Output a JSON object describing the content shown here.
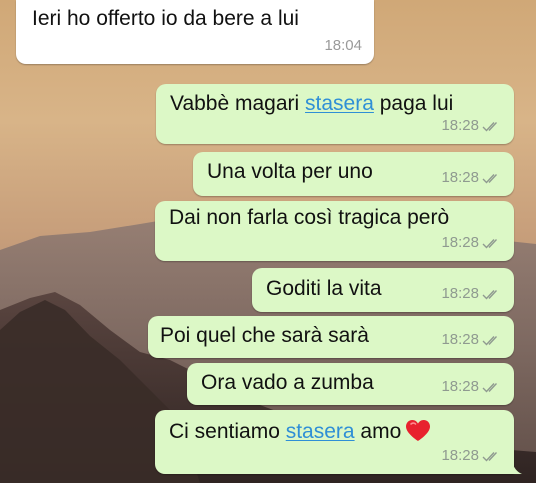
{
  "conversation": {
    "messages": [
      {
        "direction": "in",
        "text": "Ieri ho offerto io da bere a lui",
        "time": "18:04"
      },
      {
        "direction": "out",
        "parts": [
          "Vabbè magari ",
          "stasera",
          " paga lui"
        ],
        "time": "18:28",
        "status": "read"
      },
      {
        "direction": "out",
        "text": "Una volta per uno",
        "time": "18:28",
        "status": "read"
      },
      {
        "direction": "out",
        "text": "Dai non farla così tragica però",
        "time": "18:28",
        "status": "read"
      },
      {
        "direction": "out",
        "text": "Goditi la vita",
        "time": "18:28",
        "status": "read"
      },
      {
        "direction": "out",
        "text": "Poi quel che sarà sarà",
        "time": "18:28",
        "status": "read"
      },
      {
        "direction": "out",
        "text": "Ora vado a zumba",
        "time": "18:28",
        "status": "read"
      },
      {
        "direction": "out",
        "parts": [
          "Ci sentiamo ",
          "stasera",
          " amo"
        ],
        "emoji": "red-heart",
        "time": "18:28",
        "status": "read"
      }
    ]
  },
  "colors": {
    "outgoing_bubble": "#dcf8c6",
    "incoming_bubble": "#ffffff",
    "link": "#2f8fd6",
    "meta_text": "#8f9a90"
  },
  "icons": {
    "read_receipt": "double-check-icon",
    "emoji": "red-heart-icon"
  }
}
